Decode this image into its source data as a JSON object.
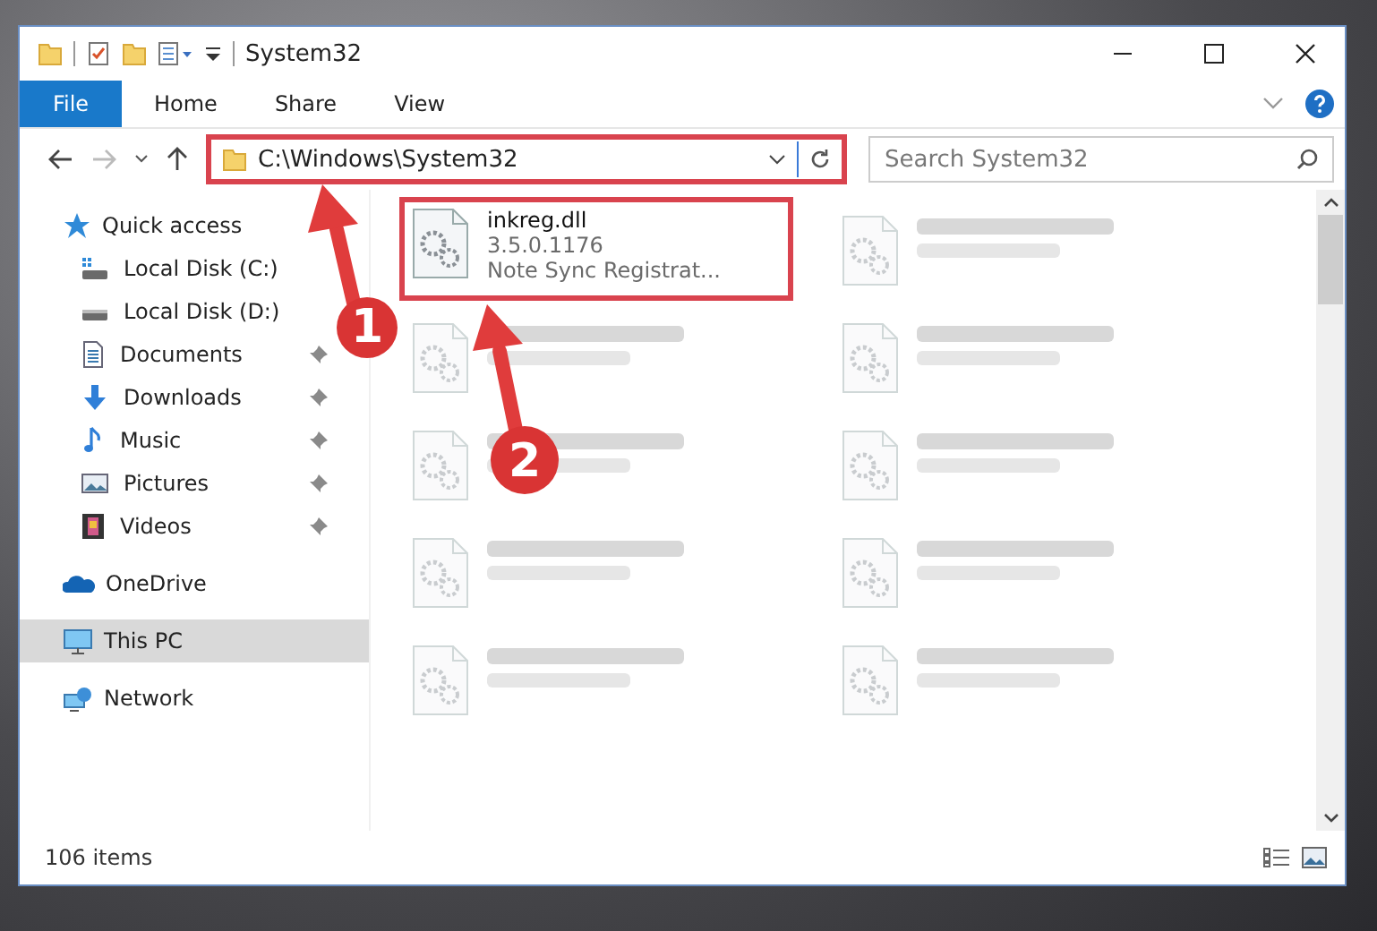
{
  "window": {
    "title": "System32"
  },
  "ribbon_tabs": [
    {
      "label": "File",
      "kind": "file"
    },
    {
      "label": "Home",
      "kind": "tab"
    },
    {
      "label": "Share",
      "kind": "tab"
    },
    {
      "label": "View",
      "kind": "tab"
    }
  ],
  "address": {
    "path": "C:\\Windows\\System32",
    "highlighted": true
  },
  "search": {
    "placeholder": "Search System32"
  },
  "sidebar": {
    "items": [
      {
        "label": "Quick access",
        "selected": false,
        "children": [
          {
            "label": "Local Disk (C:)",
            "pinned": false
          },
          {
            "label": "Local Disk (D:)",
            "pinned": false
          },
          {
            "label": "Documents",
            "pinned": true
          },
          {
            "label": "Downloads",
            "pinned": true
          },
          {
            "label": "Music",
            "pinned": true
          },
          {
            "label": "Pictures",
            "pinned": true
          },
          {
            "label": "Videos",
            "pinned": true
          }
        ]
      },
      {
        "label": "OneDrive",
        "selected": false
      },
      {
        "label": "This PC",
        "selected": true
      },
      {
        "label": "Network",
        "selected": false
      }
    ]
  },
  "files": [
    {
      "name": "inkreg.dll",
      "lines": [
        "3.5.0.1176",
        "Note Sync Registrat..."
      ],
      "blurred": false,
      "highlighted": true
    },
    {
      "blurred": true,
      "highlighted": false
    },
    {
      "blurred": true,
      "highlighted": false
    },
    {
      "blurred": true,
      "highlighted": false
    },
    {
      "blurred": true,
      "highlighted": false
    },
    {
      "blurred": true,
      "highlighted": false
    },
    {
      "blurred": true,
      "highlighted": false
    },
    {
      "blurred": true,
      "highlighted": false
    },
    {
      "blurred": true,
      "highlighted": false
    },
    {
      "blurred": true,
      "highlighted": false
    }
  ],
  "status_bar": {
    "count": "106 items"
  },
  "annotations": [
    {
      "label": "1"
    },
    {
      "label": "2"
    }
  ]
}
